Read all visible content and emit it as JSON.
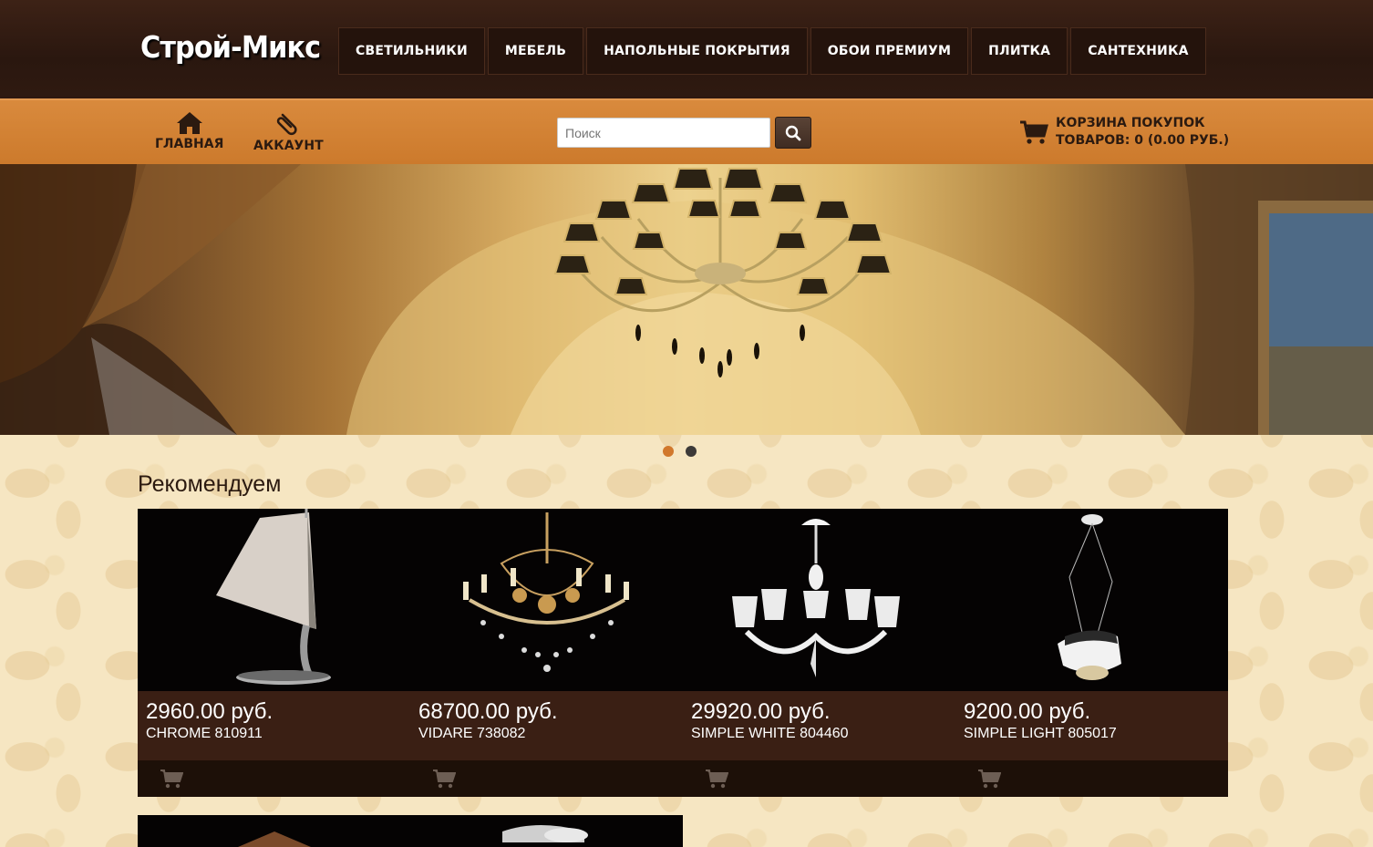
{
  "header": {
    "logo": "Строй-Микс",
    "nav": [
      {
        "label": "Светильники"
      },
      {
        "label": "Мебель"
      },
      {
        "label": "Напольные покрытия"
      },
      {
        "label": "Обои премиум"
      },
      {
        "label": "Плитка"
      },
      {
        "label": "Сантехника"
      }
    ]
  },
  "toolbar": {
    "home_label": "ГЛАВНАЯ",
    "account_label": "АККАУНТ",
    "search_placeholder": "Поиск",
    "search_value": "",
    "cart_title": "Корзина покупок",
    "cart_summary": "Товаров: 0 (0.00 руб.)"
  },
  "slider": {
    "active_index": 0,
    "dot_active_color": "#d1782c",
    "dot_color": "#3d3a38"
  },
  "colors": {
    "accent": "#d18436",
    "header_bg": "#2f1a11"
  },
  "featured": {
    "title": "Рекомендуем",
    "products": [
      {
        "price": "2960.00 руб.",
        "name": "CHROME 810911",
        "icon": "table-lamp"
      },
      {
        "price": "68700.00 руб.",
        "name": "VIDARE 738082",
        "icon": "crystal-chandelier"
      },
      {
        "price": "29920.00 руб.",
        "name": "SIMPLE WHITE 804460",
        "icon": "white-chandelier"
      },
      {
        "price": "9200.00 руб.",
        "name": "SIMPLE LIGHT 805017",
        "icon": "pendant-light"
      }
    ]
  }
}
